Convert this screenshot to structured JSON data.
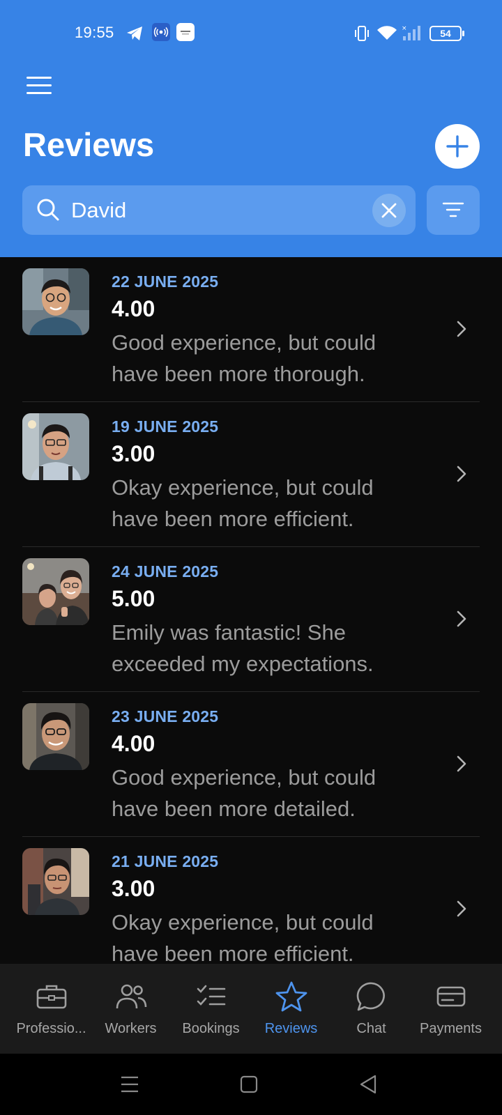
{
  "status_bar": {
    "time": "19:55",
    "battery": "54",
    "icons": [
      "telegram-icon",
      "broadcast-icon",
      "app-notification-icon",
      "vibrate-icon",
      "wifi-icon",
      "signal-icon",
      "battery-icon"
    ]
  },
  "header": {
    "title": "Reviews",
    "menu_icon": "hamburger-menu-icon",
    "add_icon": "plus-icon"
  },
  "search": {
    "value": "David",
    "placeholder": "Search",
    "clear_icon": "close-icon",
    "filter_icon": "filter-icon"
  },
  "reviews": [
    {
      "date": "22 JUNE 2025",
      "rating": "4.00",
      "text": "Good experience, but could have been more thorough."
    },
    {
      "date": "19 JUNE 2025",
      "rating": "3.00",
      "text": "Okay experience, but could have been more efficient."
    },
    {
      "date": "24 JUNE 2025",
      "rating": "5.00",
      "text": "Emily was fantastic! She exceeded my expectations."
    },
    {
      "date": "23 JUNE 2025",
      "rating": "4.00",
      "text": "Good experience, but could have been more detailed."
    },
    {
      "date": "21 JUNE 2025",
      "rating": "3.00",
      "text": "Okay experience, but could have been more efficient."
    }
  ],
  "bottom_nav": {
    "active": "Reviews",
    "items": [
      {
        "label": "Professio...",
        "icon": "briefcase-icon"
      },
      {
        "label": "Workers",
        "icon": "users-icon"
      },
      {
        "label": "Bookings",
        "icon": "checklist-icon"
      },
      {
        "label": "Reviews",
        "icon": "star-icon"
      },
      {
        "label": "Chat",
        "icon": "chat-bubble-icon"
      },
      {
        "label": "Payments",
        "icon": "credit-card-icon"
      }
    ]
  },
  "system_nav": [
    "recents-icon",
    "home-icon",
    "back-icon"
  ],
  "colors": {
    "header_blue": "#3783e6",
    "search_field": "#5b9bee",
    "date_accent": "#79aef1",
    "active_nav": "#4e94ee",
    "background": "#0b0b0b"
  }
}
